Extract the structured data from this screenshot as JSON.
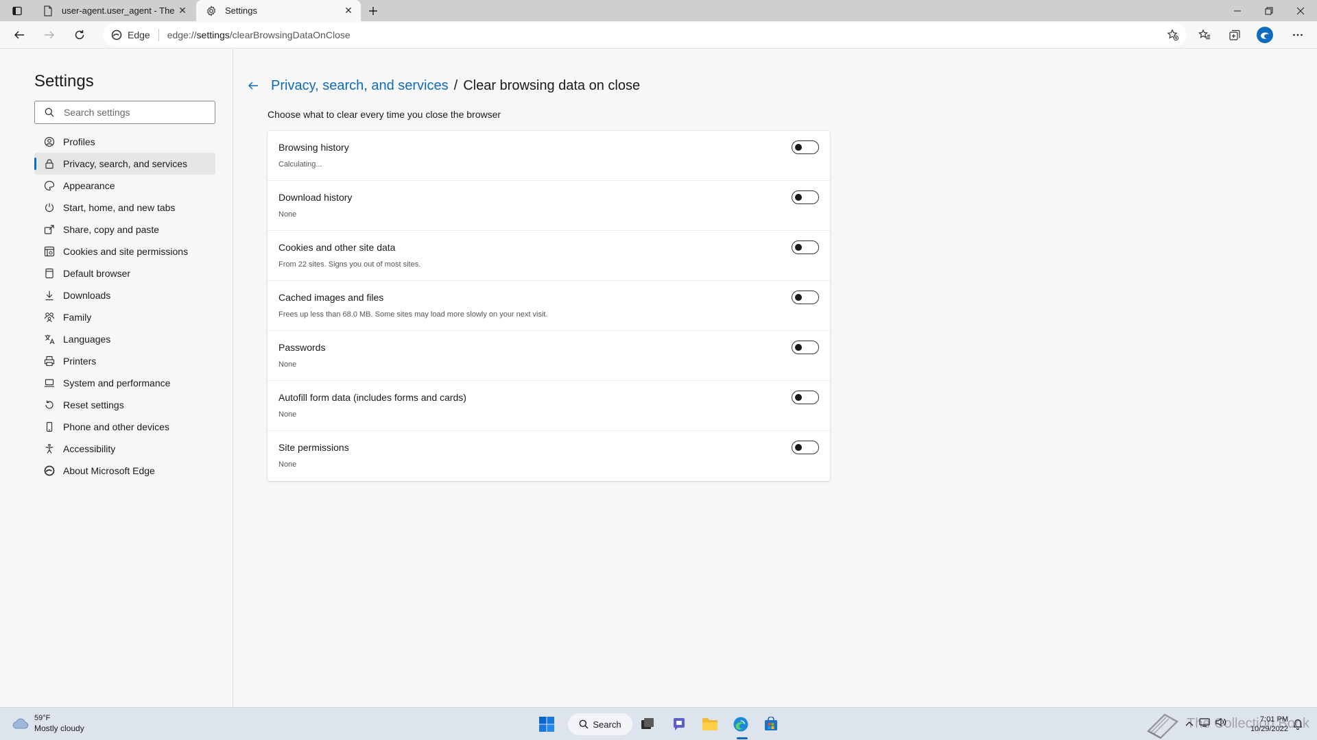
{
  "tabs": [
    {
      "title": "user-agent.user_agent - The Coll",
      "icon": "page-icon",
      "active": false
    },
    {
      "title": "Settings",
      "icon": "gear-icon",
      "active": true
    }
  ],
  "toolbar": {
    "site_label": "Edge",
    "url_prefix": "edge://",
    "url_host": "settings",
    "url_path": "/clearBrowsingDataOnClose"
  },
  "sidebar": {
    "title": "Settings",
    "search_placeholder": "Search settings",
    "items": [
      {
        "label": "Profiles",
        "icon": "profile-icon"
      },
      {
        "label": "Privacy, search, and services",
        "icon": "lock-icon",
        "active": true
      },
      {
        "label": "Appearance",
        "icon": "appearance-icon"
      },
      {
        "label": "Start, home, and new tabs",
        "icon": "power-icon"
      },
      {
        "label": "Share, copy and paste",
        "icon": "share-icon"
      },
      {
        "label": "Cookies and site permissions",
        "icon": "cookie-icon"
      },
      {
        "label": "Default browser",
        "icon": "browser-icon"
      },
      {
        "label": "Downloads",
        "icon": "download-icon"
      },
      {
        "label": "Family",
        "icon": "family-icon"
      },
      {
        "label": "Languages",
        "icon": "language-icon"
      },
      {
        "label": "Printers",
        "icon": "printer-icon"
      },
      {
        "label": "System and performance",
        "icon": "laptop-icon"
      },
      {
        "label": "Reset settings",
        "icon": "reset-icon"
      },
      {
        "label": "Phone and other devices",
        "icon": "phone-icon"
      },
      {
        "label": "Accessibility",
        "icon": "accessibility-icon"
      },
      {
        "label": "About Microsoft Edge",
        "icon": "edge-logo-icon"
      }
    ]
  },
  "main": {
    "breadcrumb_parent": "Privacy, search, and services",
    "breadcrumb_separator": "/",
    "breadcrumb_current": "Clear browsing data on close",
    "subtitle": "Choose what to clear every time you close the browser",
    "rows": [
      {
        "title": "Browsing history",
        "desc": "Calculating...",
        "on": false
      },
      {
        "title": "Download history",
        "desc": "None",
        "on": false
      },
      {
        "title": "Cookies and other site data",
        "desc": "From 22 sites. Signs you out of most sites.",
        "on": false
      },
      {
        "title": "Cached images and files",
        "desc": "Frees up less than 68.0 MB. Some sites may load more slowly on your next visit.",
        "on": false
      },
      {
        "title": "Passwords",
        "desc": "None",
        "on": false
      },
      {
        "title": "Autofill form data (includes forms and cards)",
        "desc": "None",
        "on": false
      },
      {
        "title": "Site permissions",
        "desc": "None",
        "on": false
      }
    ]
  },
  "taskbar": {
    "weather_temp": "59°F",
    "weather_condition": "Mostly cloudy",
    "search_label": "Search",
    "watermark": "The Collection Book",
    "clock_time": "7:01 PM",
    "clock_date": "10/29/2022"
  },
  "colors": {
    "accent": "#0f6cbd",
    "tabstrip": "#cfcfcf",
    "page_bg": "#f7f7f7",
    "taskbar": "#dde4ee"
  }
}
